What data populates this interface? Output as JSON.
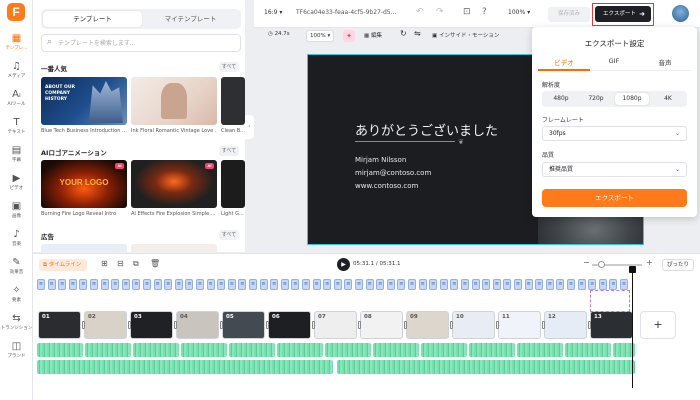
{
  "rail": {
    "items": [
      {
        "icon": "▦",
        "label": "テンプレ…"
      },
      {
        "icon": "♫",
        "label": "メディア"
      },
      {
        "icon": "Aᵢ",
        "label": "AIツール"
      },
      {
        "icon": "T",
        "label": "テキスト"
      },
      {
        "icon": "▤",
        "label": "字幕"
      },
      {
        "icon": "▶",
        "label": "ビデオ"
      },
      {
        "icon": "▣",
        "label": "画像"
      },
      {
        "icon": "♪",
        "label": "音楽"
      },
      {
        "icon": "✎",
        "label": "効果音"
      },
      {
        "icon": "✧",
        "label": "要素"
      },
      {
        "icon": "⇆",
        "label": "トランジション"
      },
      {
        "icon": "◫",
        "label": "ブランド"
      }
    ]
  },
  "panel": {
    "tabs": [
      "テンプレート",
      "マイテンプレート"
    ],
    "search_placeholder": "テンプレートを検索します...",
    "sections": [
      {
        "title": "一番人気",
        "all_label": "すべて",
        "cards": [
          "Blue Tech Business Introduction ...",
          "Ink Floral Romantic Vintage Love ...",
          "Clean B..."
        ]
      },
      {
        "title": "AIロゴアニメーション",
        "all_label": "すべて",
        "cards": [
          "Burning Fire Logo Reveal Intro",
          "AI Effects Fire Explosion Simple ...",
          "Light G..."
        ]
      },
      {
        "title": "広告",
        "all_label": "すべて",
        "cards": []
      }
    ],
    "card_texts": {
      "tech": "ABOUT OUR COMPANY HISTORY",
      "logo": "YOUR LOGO",
      "ai_badge": "AI"
    }
  },
  "topbar": {
    "aspect": "16:9",
    "project_name": "TF6ca04e33-feaa-4cf5-9b27-d5...",
    "zoom": "100%",
    "save_to": "保存済み",
    "export_label": "エクスポート"
  },
  "editbar": {
    "duration": "24.7s",
    "zoom": "100%",
    "edit_label": "編集",
    "inside_motion": "インサイド・モーション"
  },
  "slide": {
    "heading": "ありがとうございました",
    "name": "Mirjam Nilsson",
    "email": "mirjam@contoso.com",
    "website": "www.contoso.com"
  },
  "export_panel": {
    "title": "エクスポート設定",
    "tabs": [
      "ビデオ",
      "GIF",
      "音声"
    ],
    "resolution_label": "解析度",
    "resolutions": [
      "480p",
      "720p",
      "1080p",
      "4K"
    ],
    "selected_resolution": "1080p",
    "framerate_label": "フレームレート",
    "framerate_value": "30fps",
    "quality_label": "品質",
    "quality_value": "推奨品質",
    "export_button": "エクスポート"
  },
  "timeline": {
    "tag": "タイムライン",
    "time": "05:31.1 / 05:31.1",
    "fit_label": "ぴったり",
    "clips": [
      "01",
      "02",
      "03",
      "04",
      "05",
      "06",
      "07",
      "08",
      "09",
      "10",
      "11",
      "12",
      "13"
    ]
  },
  "colors": {
    "accent": "#ff7a1a",
    "export_dark": "#1e1f24",
    "slide_bg": "#1b1d20",
    "selection": "#35c7d9",
    "audio": "#78dfae",
    "subtitle_chip": "#c8d9f7"
  }
}
